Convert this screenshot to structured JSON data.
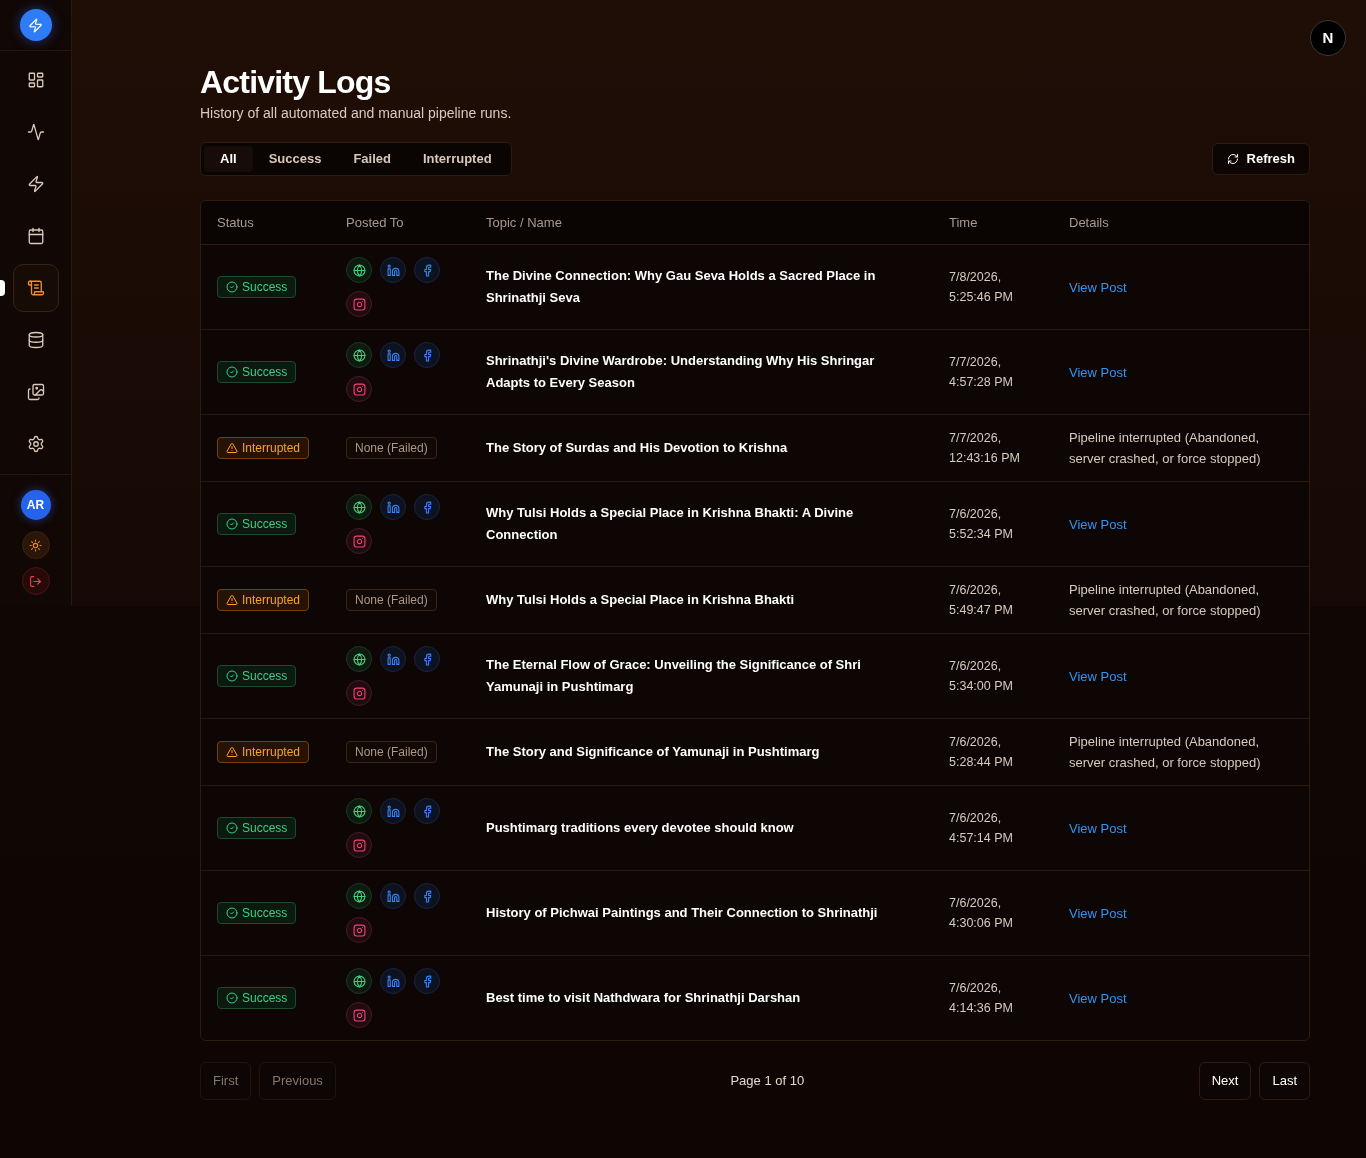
{
  "sidebar": {
    "nav": [
      {
        "selected": false
      },
      {
        "selected": false
      },
      {
        "selected": false
      },
      {
        "selected": false
      },
      {
        "selected": true
      },
      {
        "selected": false
      },
      {
        "selected": false
      },
      {
        "selected": false
      }
    ],
    "user": {
      "initials": "AR"
    }
  },
  "dev_badge": {
    "label": "N"
  },
  "header": {
    "title": "Activity Logs",
    "subtitle": "History of all automated and manual pipeline runs."
  },
  "filters": [
    {
      "label": "All",
      "selected": true
    },
    {
      "label": "Success",
      "selected": false
    },
    {
      "label": "Failed",
      "selected": false
    },
    {
      "label": "Interrupted",
      "selected": false
    }
  ],
  "refresh_button": {
    "label": "Refresh"
  },
  "table": {
    "columns": [
      "Status",
      "Posted To",
      "Topic / Name",
      "Time",
      "Details"
    ],
    "rows": [
      {
        "status": {
          "kind": "success",
          "label": "Success"
        },
        "posted_to": {
          "kind": "platforms",
          "platforms": [
            {
              "kind": "globe"
            },
            {
              "kind": "linkedin"
            },
            {
              "kind": "facebook"
            },
            {
              "kind": "instagram"
            }
          ]
        },
        "topic": "The Divine Connection: Why Gau Seva Holds a Sacred Place in Shrinathji Seva",
        "time": "7/8/2026, 5:25:46 PM",
        "details": {
          "kind": "link",
          "text": "View Post"
        }
      },
      {
        "status": {
          "kind": "success",
          "label": "Success"
        },
        "posted_to": {
          "kind": "platforms",
          "platforms": [
            {
              "kind": "globe"
            },
            {
              "kind": "linkedin"
            },
            {
              "kind": "facebook"
            },
            {
              "kind": "instagram"
            }
          ]
        },
        "topic": "Shrinathji's Divine Wardrobe: Understanding Why His Shringar Adapts to Every Season",
        "time": "7/7/2026, 4:57:28 PM",
        "details": {
          "kind": "link",
          "text": "View Post"
        }
      },
      {
        "status": {
          "kind": "interrupted",
          "label": "Interrupted"
        },
        "posted_to": {
          "kind": "none",
          "label": "None (Failed)"
        },
        "topic": "The Story of Surdas and His Devotion to Krishna",
        "time": "7/7/2026, 12:43:16 PM",
        "details": {
          "kind": "text",
          "text": "Pipeline interrupted (Abandoned, server crashed, or force stopped)"
        }
      },
      {
        "status": {
          "kind": "success",
          "label": "Success"
        },
        "posted_to": {
          "kind": "platforms",
          "platforms": [
            {
              "kind": "globe"
            },
            {
              "kind": "linkedin"
            },
            {
              "kind": "facebook"
            },
            {
              "kind": "instagram"
            }
          ]
        },
        "topic": "Why Tulsi Holds a Special Place in Krishna Bhakti: A Divine Connection",
        "time": "7/6/2026, 5:52:34 PM",
        "details": {
          "kind": "link",
          "text": "View Post"
        }
      },
      {
        "status": {
          "kind": "interrupted",
          "label": "Interrupted"
        },
        "posted_to": {
          "kind": "none",
          "label": "None (Failed)"
        },
        "topic": "Why Tulsi Holds a Special Place in Krishna Bhakti",
        "time": "7/6/2026, 5:49:47 PM",
        "details": {
          "kind": "text",
          "text": "Pipeline interrupted (Abandoned, server crashed, or force stopped)"
        }
      },
      {
        "status": {
          "kind": "success",
          "label": "Success"
        },
        "posted_to": {
          "kind": "platforms",
          "platforms": [
            {
              "kind": "globe"
            },
            {
              "kind": "linkedin"
            },
            {
              "kind": "facebook"
            },
            {
              "kind": "instagram"
            }
          ]
        },
        "topic": "The Eternal Flow of Grace: Unveiling the Significance of Shri Yamunaji in Pushtimarg",
        "time": "7/6/2026, 5:34:00 PM",
        "details": {
          "kind": "link",
          "text": "View Post"
        }
      },
      {
        "status": {
          "kind": "interrupted",
          "label": "Interrupted"
        },
        "posted_to": {
          "kind": "none",
          "label": "None (Failed)"
        },
        "topic": "The Story and Significance of Yamunaji in Pushtimarg",
        "time": "7/6/2026, 5:28:44 PM",
        "details": {
          "kind": "text",
          "text": "Pipeline interrupted (Abandoned, server crashed, or force stopped)"
        }
      },
      {
        "status": {
          "kind": "success",
          "label": "Success"
        },
        "posted_to": {
          "kind": "platforms",
          "platforms": [
            {
              "kind": "globe"
            },
            {
              "kind": "linkedin"
            },
            {
              "kind": "facebook"
            },
            {
              "kind": "instagram"
            }
          ]
        },
        "topic": "Pushtimarg traditions every devotee should know",
        "time": "7/6/2026, 4:57:14 PM",
        "details": {
          "kind": "link",
          "text": "View Post"
        }
      },
      {
        "status": {
          "kind": "success",
          "label": "Success"
        },
        "posted_to": {
          "kind": "platforms",
          "platforms": [
            {
              "kind": "globe"
            },
            {
              "kind": "linkedin"
            },
            {
              "kind": "facebook"
            },
            {
              "kind": "instagram"
            }
          ]
        },
        "topic": "History of Pichwai Paintings and Their Connection to Shrinathji",
        "time": "7/6/2026, 4:30:06 PM",
        "details": {
          "kind": "link",
          "text": "View Post"
        }
      },
      {
        "status": {
          "kind": "success",
          "label": "Success"
        },
        "posted_to": {
          "kind": "platforms",
          "platforms": [
            {
              "kind": "globe"
            },
            {
              "kind": "linkedin"
            },
            {
              "kind": "facebook"
            },
            {
              "kind": "instagram"
            }
          ]
        },
        "topic": "Best time to visit Nathdwara for Shrinathji Darshan",
        "time": "7/6/2026, 4:14:36 PM",
        "details": {
          "kind": "link",
          "text": "View Post"
        }
      }
    ]
  },
  "pagination": {
    "left": [
      {
        "label": "First",
        "disabled": true
      },
      {
        "label": "Previous",
        "disabled": true
      }
    ],
    "page_label": "Page 1 of 10",
    "right": [
      {
        "label": "Next",
        "disabled": false
      },
      {
        "label": "Last",
        "disabled": false
      }
    ]
  }
}
